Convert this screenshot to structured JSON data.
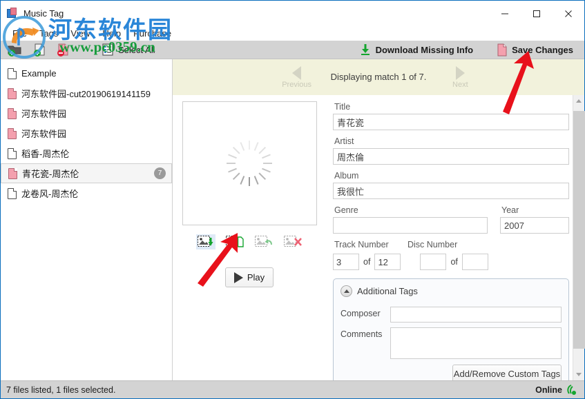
{
  "window": {
    "title": "Music Tag",
    "icon": "music-tag-app-icon",
    "controls": {
      "minimize": "—",
      "maximize": "□",
      "close": "✕"
    }
  },
  "menubar": {
    "items": [
      {
        "label": "File",
        "name": "menu-file"
      },
      {
        "label": "Tags",
        "name": "menu-tags"
      },
      {
        "label": "View",
        "name": "menu-view"
      },
      {
        "label": "Help",
        "name": "menu-help"
      },
      {
        "label": "Purchase",
        "name": "menu-purchase"
      }
    ]
  },
  "toolbar": {
    "left": [
      {
        "label": "",
        "icon": "add-folder-icon",
        "name": "add-folder-button"
      },
      {
        "label": "",
        "icon": "add-file-icon",
        "name": "add-file-button"
      },
      {
        "label": "",
        "icon": "remove-file-icon",
        "name": "remove-file-button"
      },
      {
        "label": "Select All",
        "icon": "select-all-icon",
        "name": "select-all-button"
      }
    ],
    "download_missing_info": "Download Missing Info",
    "save_changes": "Save Changes"
  },
  "filelist": {
    "items": [
      {
        "name": "Example",
        "pink": false,
        "badge": ""
      },
      {
        "name": "河东软件园-cut20190619141159",
        "pink": true,
        "badge": ""
      },
      {
        "name": "河东软件园",
        "pink": true,
        "badge": ""
      },
      {
        "name": "河东软件园",
        "pink": true,
        "badge": ""
      },
      {
        "name": "稻香-周杰伦",
        "pink": false,
        "badge": ""
      },
      {
        "name": "青花瓷-周杰伦",
        "pink": true,
        "badge": "7",
        "selected": true
      },
      {
        "name": "龙卷风-周杰伦",
        "pink": false,
        "badge": ""
      }
    ]
  },
  "match_banner": {
    "previous_label": "Previous",
    "text": "Displaying match 1 of 7.",
    "next_label": "Next"
  },
  "artwork": {
    "state": "loading",
    "actions": [
      {
        "name": "download-art-button",
        "icon": "image-download-icon",
        "active": true
      },
      {
        "name": "save-art-to-file-button",
        "icon": "image-save-icon",
        "active": false
      },
      {
        "name": "revert-art-button",
        "icon": "image-revert-icon",
        "active": false
      },
      {
        "name": "delete-art-button",
        "icon": "image-delete-icon",
        "active": false
      }
    ],
    "play_label": "Play"
  },
  "fields": {
    "title": {
      "label": "Title",
      "value": "青花瓷",
      "placeholder": ""
    },
    "artist": {
      "label": "Artist",
      "value": "周杰倫",
      "placeholder": ""
    },
    "album": {
      "label": "Album",
      "value": "我很忙",
      "placeholder": ""
    },
    "genre": {
      "label": "Genre",
      "value": "",
      "placeholder": ""
    },
    "year": {
      "label": "Year",
      "value": "2007",
      "placeholder": ""
    },
    "track_number": {
      "label": "Track Number",
      "value": "3",
      "of": "of",
      "total": "12"
    },
    "disc_number": {
      "label": "Disc Number",
      "value": "",
      "of": "of",
      "total": ""
    }
  },
  "additional_tags": {
    "title": "Additional Tags",
    "collapse_icon": "chevron-up-icon",
    "composer": {
      "label": "Composer",
      "value": "",
      "placeholder": ""
    },
    "comments": {
      "label": "Comments",
      "value": "",
      "placeholder": ""
    },
    "custom_tags_button": "Add/Remove Custom Tags"
  },
  "statusbar": {
    "files_text": "7 files listed, 1 files selected.",
    "online_text": "Online",
    "online_icon": "signal-online-icon"
  },
  "watermark": {
    "site_name": "河东软件园",
    "url": "www.pc0359.cn"
  },
  "colors": {
    "accent": "#0a6ebd",
    "toolbar_bg": "#d3d3d3",
    "banner_bg": "#f2f2dc",
    "watermark_blue": "#2a86d8",
    "watermark_green": "#179c3c",
    "arrow_red": "#e8111b",
    "pink_file": "#f4a0ae",
    "green_accent": "#15a52f"
  }
}
